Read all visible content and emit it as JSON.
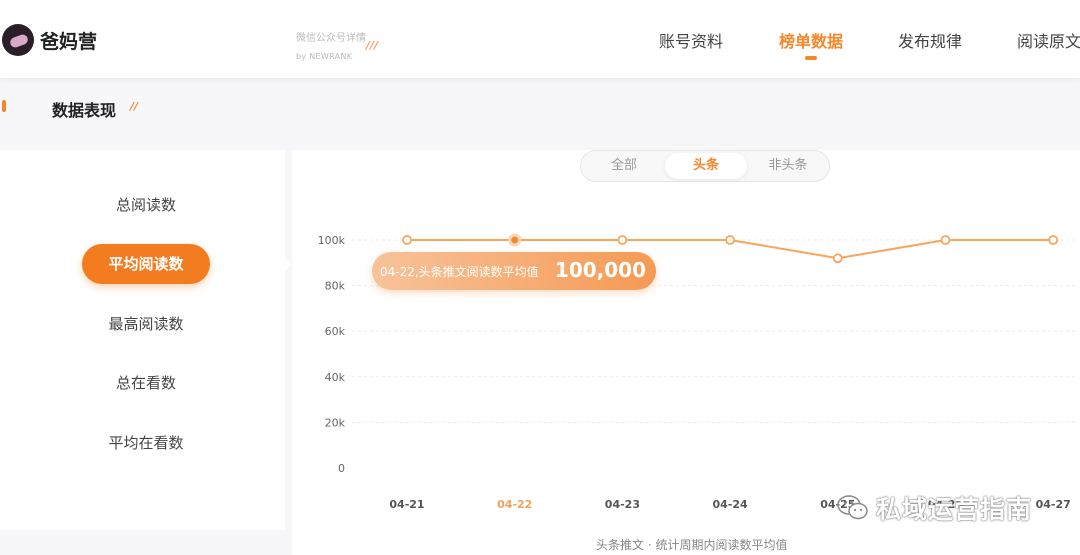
{
  "header": {
    "logo_text": "爸妈营",
    "sub_brand_title": "微信公众号详情",
    "sub_brand_by": "by NEWRANK",
    "sub_brand_marks": "///",
    "nav": [
      {
        "label": "账号资料",
        "active": false
      },
      {
        "label": "榜单数据",
        "active": true
      },
      {
        "label": "发布规律",
        "active": false
      },
      {
        "label": "阅读原文",
        "active": false
      }
    ]
  },
  "section": {
    "title": "数据表现",
    "marks": "//"
  },
  "metrics": [
    {
      "label": "总阅读数",
      "active": false
    },
    {
      "label": "平均阅读数",
      "active": true
    },
    {
      "label": "最高阅读数",
      "active": false
    },
    {
      "label": "总在看数",
      "active": false
    },
    {
      "label": "平均在看数",
      "active": false
    }
  ],
  "tabs": [
    {
      "label": "全部",
      "active": false
    },
    {
      "label": "头条",
      "active": true
    },
    {
      "label": "非头条",
      "active": false
    }
  ],
  "tooltip": {
    "label": "04-22,头条推文阅读数平均值",
    "value": "100,000"
  },
  "caption": "头条推文 · 统计周期内阅读数平均值",
  "watermark": {
    "text": "私域运营指南",
    "icon": "wechat-icon"
  },
  "colors": {
    "accent": "#f5882b",
    "line": "#f9a55a"
  },
  "chart_data": {
    "type": "line",
    "x": [
      "04-21",
      "04-22",
      "04-23",
      "04-24",
      "04-25",
      "04-26",
      "04-27"
    ],
    "series": [
      {
        "values": [
          100000,
          100000,
          100000,
          100000,
          92000,
          100000,
          100000
        ]
      }
    ],
    "y_ticks": [
      "0",
      "20k",
      "40k",
      "60k",
      "80k",
      "100k"
    ],
    "ylim": [
      0,
      100000
    ],
    "highlight_x": "04-22",
    "grid": true
  }
}
